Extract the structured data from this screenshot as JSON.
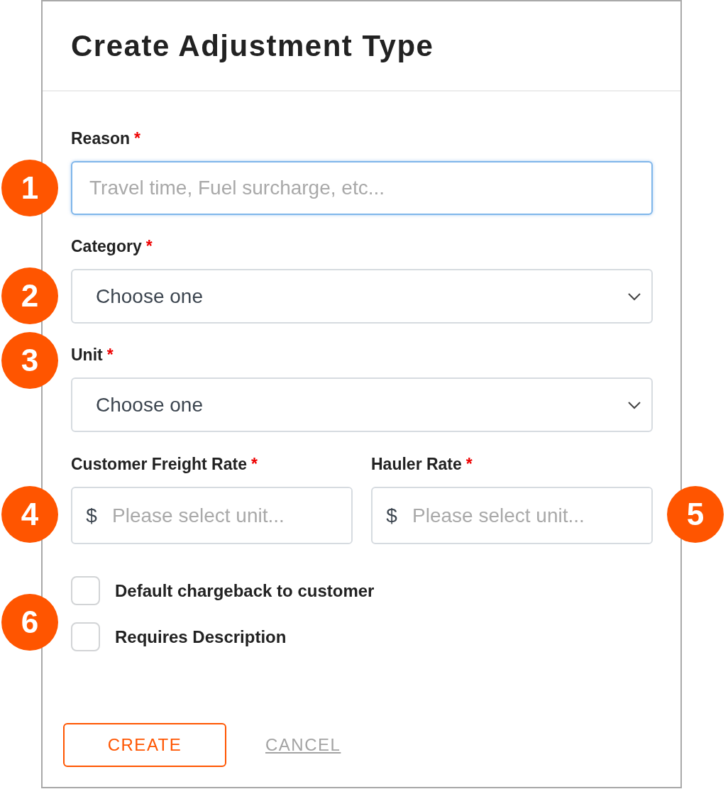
{
  "dialog": {
    "title": "Create Adjustment Type"
  },
  "fields": [
    {
      "kind": "text",
      "label": "Reason",
      "required_mark": "*",
      "placeholder": "Travel time, Fuel surcharge, etc...",
      "focused": true
    },
    {
      "kind": "select",
      "label": "Category",
      "required_mark": "*",
      "value": "Choose one",
      "focused": false
    },
    {
      "kind": "select",
      "label": "Unit",
      "required_mark": "*",
      "value": "Choose one",
      "focused": false
    }
  ],
  "rate_fields": [
    {
      "label": "Customer Freight Rate",
      "required_mark": "*",
      "prefix": "$",
      "placeholder": "Please select unit..."
    },
    {
      "label": "Hauler Rate",
      "required_mark": "*",
      "prefix": "$",
      "placeholder": "Please select unit..."
    }
  ],
  "checkboxes": [
    {
      "label": "Default chargeback to customer",
      "checked": false
    },
    {
      "label": "Requires Description",
      "checked": false
    }
  ],
  "buttons": [
    {
      "kind": "primary",
      "label": "CREATE"
    },
    {
      "kind": "link",
      "label": "CANCEL"
    }
  ],
  "callouts": [
    "1",
    "2",
    "3",
    "4",
    "5",
    "6"
  ]
}
